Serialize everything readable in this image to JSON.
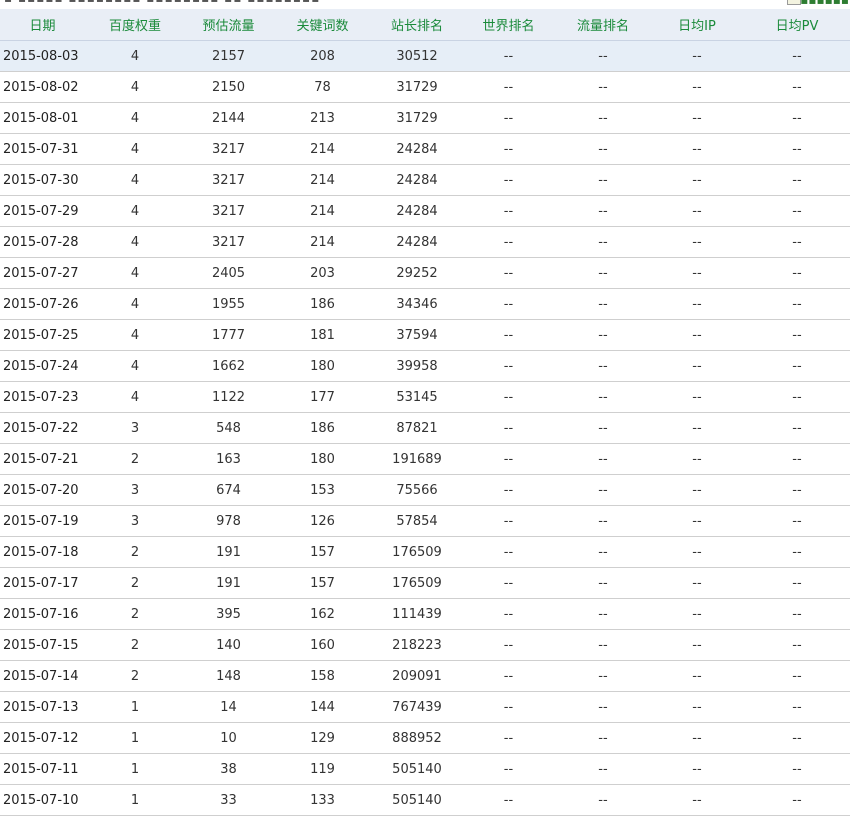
{
  "topbar": {
    "left_text": "▪ ▪▪▪▪▪ ▪▪▪▪▪▪▪▪ ▪▪▪▪▪▪▪▪ ▪▪ ▪▪▪▪▪▪▪▪",
    "right_text": "▪▪▪▪▪▪"
  },
  "table": {
    "headers": {
      "date": "日期",
      "baidu_weight": "百度权重",
      "est_traffic": "预估流量",
      "keywords": "关键词数",
      "webmaster_rank": "站长排名",
      "world_rank": "世界排名",
      "traffic_rank": "流量排名",
      "daily_ip": "日均IP",
      "daily_pv": "日均PV"
    },
    "rows": [
      {
        "date": "2015-08-03",
        "baidu_weight": "4",
        "est_traffic": "2157",
        "keywords": "208",
        "webmaster_rank": "30512",
        "world_rank": "--",
        "traffic_rank": "--",
        "daily_ip": "--",
        "daily_pv": "--"
      },
      {
        "date": "2015-08-02",
        "baidu_weight": "4",
        "est_traffic": "2150",
        "keywords": "78",
        "webmaster_rank": "31729",
        "world_rank": "--",
        "traffic_rank": "--",
        "daily_ip": "--",
        "daily_pv": "--"
      },
      {
        "date": "2015-08-01",
        "baidu_weight": "4",
        "est_traffic": "2144",
        "keywords": "213",
        "webmaster_rank": "31729",
        "world_rank": "--",
        "traffic_rank": "--",
        "daily_ip": "--",
        "daily_pv": "--"
      },
      {
        "date": "2015-07-31",
        "baidu_weight": "4",
        "est_traffic": "3217",
        "keywords": "214",
        "webmaster_rank": "24284",
        "world_rank": "--",
        "traffic_rank": "--",
        "daily_ip": "--",
        "daily_pv": "--"
      },
      {
        "date": "2015-07-30",
        "baidu_weight": "4",
        "est_traffic": "3217",
        "keywords": "214",
        "webmaster_rank": "24284",
        "world_rank": "--",
        "traffic_rank": "--",
        "daily_ip": "--",
        "daily_pv": "--"
      },
      {
        "date": "2015-07-29",
        "baidu_weight": "4",
        "est_traffic": "3217",
        "keywords": "214",
        "webmaster_rank": "24284",
        "world_rank": "--",
        "traffic_rank": "--",
        "daily_ip": "--",
        "daily_pv": "--"
      },
      {
        "date": "2015-07-28",
        "baidu_weight": "4",
        "est_traffic": "3217",
        "keywords": "214",
        "webmaster_rank": "24284",
        "world_rank": "--",
        "traffic_rank": "--",
        "daily_ip": "--",
        "daily_pv": "--"
      },
      {
        "date": "2015-07-27",
        "baidu_weight": "4",
        "est_traffic": "2405",
        "keywords": "203",
        "webmaster_rank": "29252",
        "world_rank": "--",
        "traffic_rank": "--",
        "daily_ip": "--",
        "daily_pv": "--"
      },
      {
        "date": "2015-07-26",
        "baidu_weight": "4",
        "est_traffic": "1955",
        "keywords": "186",
        "webmaster_rank": "34346",
        "world_rank": "--",
        "traffic_rank": "--",
        "daily_ip": "--",
        "daily_pv": "--"
      },
      {
        "date": "2015-07-25",
        "baidu_weight": "4",
        "est_traffic": "1777",
        "keywords": "181",
        "webmaster_rank": "37594",
        "world_rank": "--",
        "traffic_rank": "--",
        "daily_ip": "--",
        "daily_pv": "--"
      },
      {
        "date": "2015-07-24",
        "baidu_weight": "4",
        "est_traffic": "1662",
        "keywords": "180",
        "webmaster_rank": "39958",
        "world_rank": "--",
        "traffic_rank": "--",
        "daily_ip": "--",
        "daily_pv": "--"
      },
      {
        "date": "2015-07-23",
        "baidu_weight": "4",
        "est_traffic": "1122",
        "keywords": "177",
        "webmaster_rank": "53145",
        "world_rank": "--",
        "traffic_rank": "--",
        "daily_ip": "--",
        "daily_pv": "--"
      },
      {
        "date": "2015-07-22",
        "baidu_weight": "3",
        "est_traffic": "548",
        "keywords": "186",
        "webmaster_rank": "87821",
        "world_rank": "--",
        "traffic_rank": "--",
        "daily_ip": "--",
        "daily_pv": "--"
      },
      {
        "date": "2015-07-21",
        "baidu_weight": "2",
        "est_traffic": "163",
        "keywords": "180",
        "webmaster_rank": "191689",
        "world_rank": "--",
        "traffic_rank": "--",
        "daily_ip": "--",
        "daily_pv": "--"
      },
      {
        "date": "2015-07-20",
        "baidu_weight": "3",
        "est_traffic": "674",
        "keywords": "153",
        "webmaster_rank": "75566",
        "world_rank": "--",
        "traffic_rank": "--",
        "daily_ip": "--",
        "daily_pv": "--"
      },
      {
        "date": "2015-07-19",
        "baidu_weight": "3",
        "est_traffic": "978",
        "keywords": "126",
        "webmaster_rank": "57854",
        "world_rank": "--",
        "traffic_rank": "--",
        "daily_ip": "--",
        "daily_pv": "--"
      },
      {
        "date": "2015-07-18",
        "baidu_weight": "2",
        "est_traffic": "191",
        "keywords": "157",
        "webmaster_rank": "176509",
        "world_rank": "--",
        "traffic_rank": "--",
        "daily_ip": "--",
        "daily_pv": "--"
      },
      {
        "date": "2015-07-17",
        "baidu_weight": "2",
        "est_traffic": "191",
        "keywords": "157",
        "webmaster_rank": "176509",
        "world_rank": "--",
        "traffic_rank": "--",
        "daily_ip": "--",
        "daily_pv": "--"
      },
      {
        "date": "2015-07-16",
        "baidu_weight": "2",
        "est_traffic": "395",
        "keywords": "162",
        "webmaster_rank": "111439",
        "world_rank": "--",
        "traffic_rank": "--",
        "daily_ip": "--",
        "daily_pv": "--"
      },
      {
        "date": "2015-07-15",
        "baidu_weight": "2",
        "est_traffic": "140",
        "keywords": "160",
        "webmaster_rank": "218223",
        "world_rank": "--",
        "traffic_rank": "--",
        "daily_ip": "--",
        "daily_pv": "--"
      },
      {
        "date": "2015-07-14",
        "baidu_weight": "2",
        "est_traffic": "148",
        "keywords": "158",
        "webmaster_rank": "209091",
        "world_rank": "--",
        "traffic_rank": "--",
        "daily_ip": "--",
        "daily_pv": "--"
      },
      {
        "date": "2015-07-13",
        "baidu_weight": "1",
        "est_traffic": "14",
        "keywords": "144",
        "webmaster_rank": "767439",
        "world_rank": "--",
        "traffic_rank": "--",
        "daily_ip": "--",
        "daily_pv": "--"
      },
      {
        "date": "2015-07-12",
        "baidu_weight": "1",
        "est_traffic": "10",
        "keywords": "129",
        "webmaster_rank": "888952",
        "world_rank": "--",
        "traffic_rank": "--",
        "daily_ip": "--",
        "daily_pv": "--"
      },
      {
        "date": "2015-07-11",
        "baidu_weight": "1",
        "est_traffic": "38",
        "keywords": "119",
        "webmaster_rank": "505140",
        "world_rank": "--",
        "traffic_rank": "--",
        "daily_ip": "--",
        "daily_pv": "--"
      },
      {
        "date": "2015-07-10",
        "baidu_weight": "1",
        "est_traffic": "33",
        "keywords": "133",
        "webmaster_rank": "505140",
        "world_rank": "--",
        "traffic_rank": "--",
        "daily_ip": "--",
        "daily_pv": "--"
      }
    ]
  },
  "colors": {
    "header_bg": "#e9eef6",
    "header_text": "#1a8a3a",
    "highlight_row_bg": "#e6eef7",
    "row_border": "#cfcfcf"
  }
}
